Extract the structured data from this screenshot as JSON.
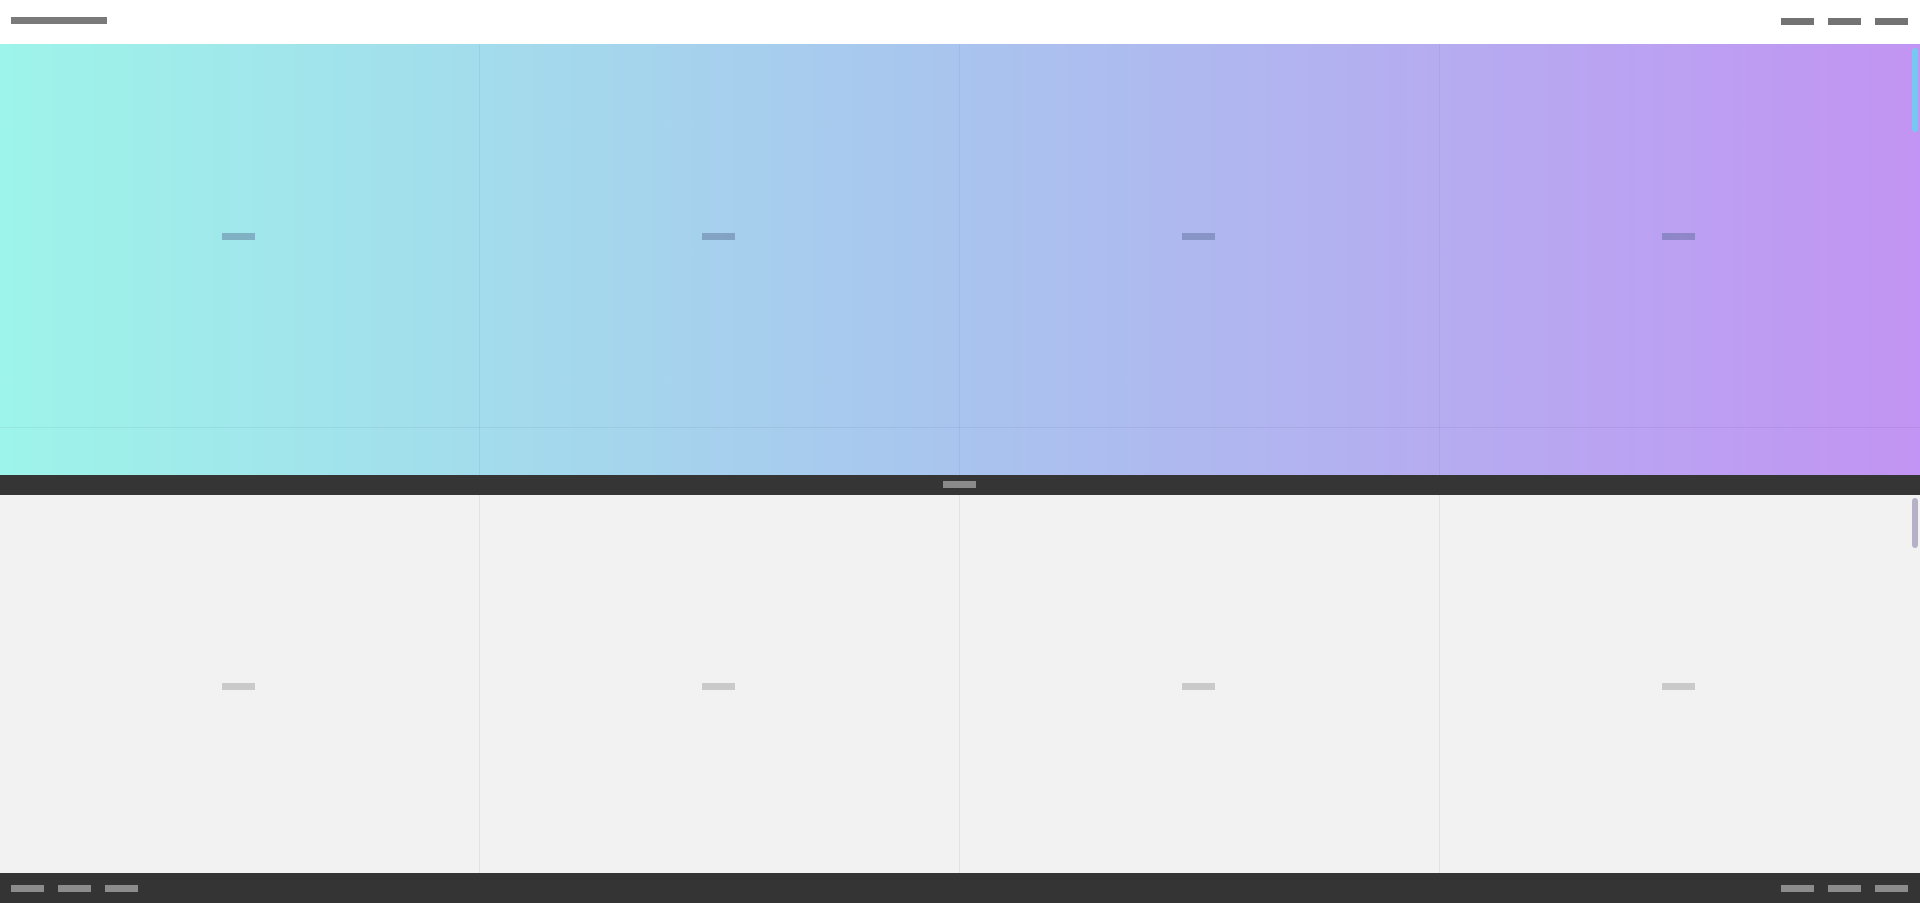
{
  "header": {
    "brand_icon": "text-placeholder-bar",
    "nav": [
      {
        "name": "nav-item-1"
      },
      {
        "name": "nav-item-2"
      },
      {
        "name": "nav-item-3"
      }
    ]
  },
  "top_pane": {
    "gradient": {
      "start": "#9df4ea",
      "middle": "#a9c4ee",
      "end": "#c294f3"
    },
    "scrollbar_color": "#76c8f1",
    "columns": 4
  },
  "splitter": {
    "color": "#353535",
    "grip_icon": "drag-handle-icon"
  },
  "bottom_pane": {
    "background": "#f2f2f2",
    "scrollbar_color": "#b6b1c6",
    "columns": 4
  },
  "footer": {
    "background": "#343434",
    "left_items": 3,
    "right_items": 3
  }
}
